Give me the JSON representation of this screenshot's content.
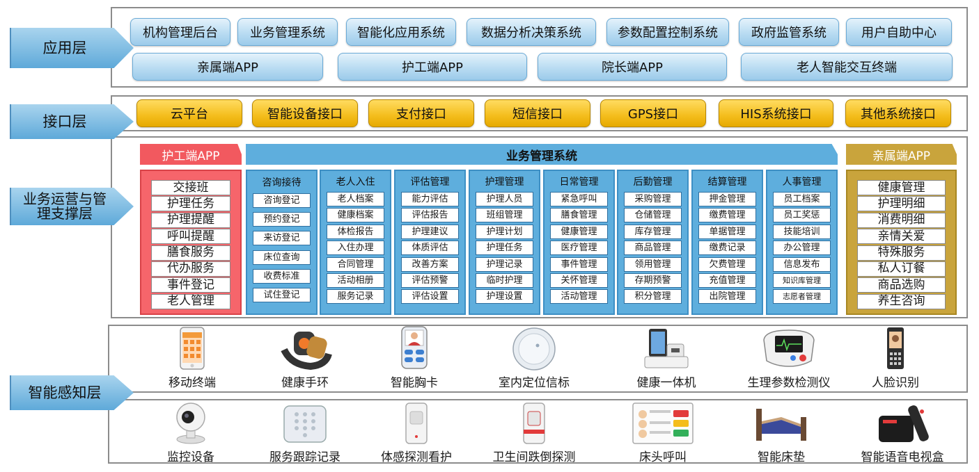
{
  "layers": {
    "application": "应用层",
    "interface": "接口层",
    "business": [
      "业务运营与管",
      "理支撑层"
    ],
    "perception": "智能感知层"
  },
  "application": {
    "row1": [
      "机构管理后台",
      "业务管理系统",
      "智能化应用系统",
      "数据分析决策系统",
      "参数配置控制系统",
      "政府监管系统",
      "用户自助中心"
    ],
    "row2": [
      "亲属端APP",
      "护工端APP",
      "院长端APP",
      "老人智能交互终端"
    ]
  },
  "interfaces": [
    "云平台",
    "智能设备接口",
    "支付接口",
    "短信接口",
    "GPS接口",
    "HIS系统接口",
    "其他系统接口"
  ],
  "caregiver": {
    "title": "护工端APP",
    "items": [
      "交接班",
      "护理任务",
      "护理提醒",
      "呼叫提醒",
      "膳食服务",
      "代办服务",
      "事件登记",
      "老人管理"
    ]
  },
  "business_system": {
    "title": "业务管理系统",
    "modules": [
      {
        "title": "咨询接待",
        "items": [
          "咨询登记",
          "预约登记",
          "来访登记",
          "床位查询",
          "收费标准",
          "试住登记"
        ]
      },
      {
        "title": "老人入住",
        "items": [
          "老人档案",
          "健康档案",
          "体检报告",
          "入住办理",
          "合同管理",
          "活动相册",
          "服务记录"
        ]
      },
      {
        "title": "评估管理",
        "items": [
          "能力评估",
          "评估报告",
          "护理建议",
          "体质评估",
          "改善方案",
          "评估预警",
          "评估设置"
        ]
      },
      {
        "title": "护理管理",
        "items": [
          "护理人员",
          "班组管理",
          "护理计划",
          "护理任务",
          "护理记录",
          "临时护理",
          "护理设置"
        ]
      },
      {
        "title": "日常管理",
        "items": [
          "紧急呼叫",
          "膳食管理",
          "健康管理",
          "医疗管理",
          "事件管理",
          "关怀管理",
          "活动管理"
        ]
      },
      {
        "title": "后勤管理",
        "items": [
          "采购管理",
          "仓储管理",
          "库存管理",
          "商品管理",
          "领用管理",
          "存期预警",
          "积分管理"
        ]
      },
      {
        "title": "结算管理",
        "items": [
          "押金管理",
          "缴费管理",
          "单据管理",
          "缴费记录",
          "欠费管理",
          "充值管理",
          "出院管理"
        ]
      },
      {
        "title": "人事管理",
        "items": [
          "员工档案",
          "员工奖惩",
          "技能培训",
          "办公管理",
          "信息发布",
          "知识库管理",
          "志愿者管理"
        ]
      }
    ]
  },
  "family": {
    "title": "亲属端APP",
    "items": [
      "健康管理",
      "护理明细",
      "消费明细",
      "亲情关爱",
      "特殊服务",
      "私人订餐",
      "商品选购",
      "养生咨询"
    ]
  },
  "devices_row1": [
    {
      "label": "移动终端",
      "icon": "phone-icon"
    },
    {
      "label": "健康手环",
      "icon": "wristband-icon"
    },
    {
      "label": "智能胸卡",
      "icon": "badge-icon"
    },
    {
      "label": "室内定位信标",
      "icon": "beacon-icon"
    },
    {
      "label": "健康一体机",
      "icon": "kiosk-icon"
    },
    {
      "label": "生理参数检测仪",
      "icon": "monitor-icon"
    },
    {
      "label": "人脸识别",
      "icon": "face-scan-icon"
    }
  ],
  "devices_row2": [
    {
      "label": "监控设备",
      "icon": "camera-icon"
    },
    {
      "label": "服务跟踪记录",
      "icon": "keypad-icon"
    },
    {
      "label": "体感探测看护",
      "icon": "motion-sensor-icon"
    },
    {
      "label": "卫生间跌倒探测",
      "icon": "fall-sensor-icon"
    },
    {
      "label": "床头呼叫",
      "icon": "bed-call-icon"
    },
    {
      "label": "智能床垫",
      "icon": "bed-icon"
    },
    {
      "label": "智能语音电视盒",
      "icon": "tv-box-icon"
    }
  ],
  "colors": {
    "blue": "#5eaedd",
    "red": "#f6656b",
    "gold": "#c9a43c",
    "yellow": "#f4bd1c"
  }
}
